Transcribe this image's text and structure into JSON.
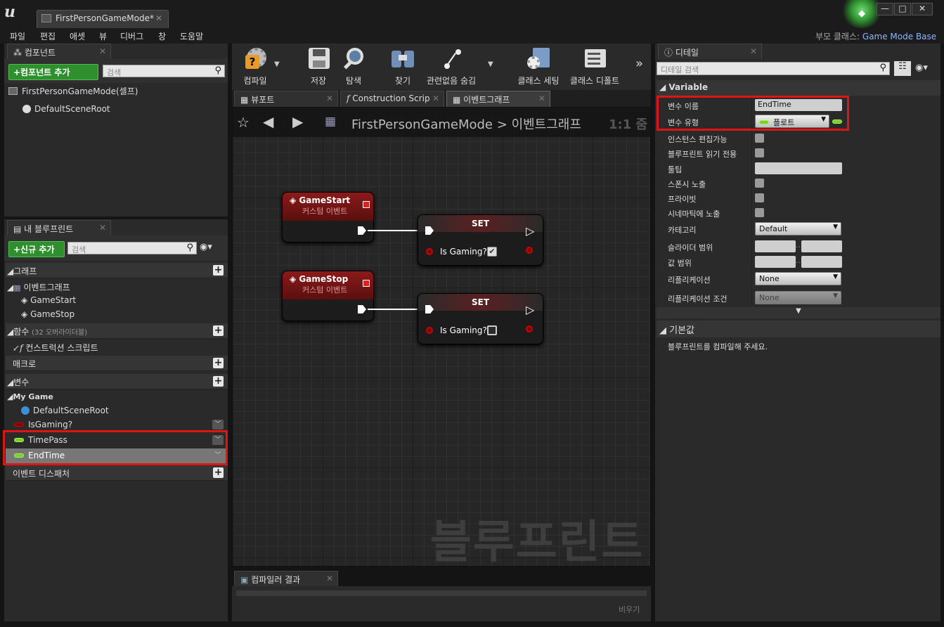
{
  "window": {
    "tab_title": "FirstPersonGameMode*",
    "parent_class_label": "부모 클래스:",
    "parent_class_value": "Game Mode Base",
    "min": "—",
    "max": "□",
    "close": "✕"
  },
  "menu": [
    "파일",
    "편집",
    "애셋",
    "뷰",
    "디버그",
    "창",
    "도움말"
  ],
  "components": {
    "tab": "컴포넌트",
    "add_button": "+컴포넌트 추가",
    "search_placeholder": "검색",
    "root": "FirstPersonGameMode(셀프)",
    "child": "DefaultSceneRoot"
  },
  "my_blueprint": {
    "tab": "내 블루프린트",
    "add_button": "+신규 추가",
    "search_placeholder": "검색",
    "graph_header": "그래프",
    "event_graph": "이벤트그래프",
    "events": [
      "GameStart",
      "GameStop"
    ],
    "functions_header": "함수",
    "functions_note": "(32 오버라이더블)",
    "construction_script": "컨스트럭션 스크립트",
    "macros_header": "매크로",
    "variables_header": "변수",
    "var_group": "My Game",
    "variables": [
      {
        "name": "DefaultSceneRoot",
        "type": "component"
      },
      {
        "name": "IsGaming?",
        "type": "bool",
        "color": "#8a0000"
      },
      {
        "name": "TimePass",
        "type": "float",
        "color": "#7ad02a"
      },
      {
        "name": "EndTime",
        "type": "float",
        "color": "#7ad02a"
      }
    ],
    "dispatchers_header": "이벤트 디스패처"
  },
  "toolbar": [
    {
      "label": "컴파일",
      "icon": "compile-icon"
    },
    {
      "label": "저장",
      "icon": "save-icon"
    },
    {
      "label": "탐색",
      "icon": "browse-icon"
    },
    {
      "label": "찾기",
      "icon": "find-icon"
    },
    {
      "label": "관련없음 숨김",
      "icon": "hide-unrelated-icon"
    },
    {
      "label": "클래스 세팅",
      "icon": "class-settings-icon"
    },
    {
      "label": "클래스 디폴트",
      "icon": "class-defaults-icon"
    }
  ],
  "editor_tabs": [
    "뷰포트",
    "Construction Scrip",
    "이벤트그래프"
  ],
  "graph": {
    "breadcrumb_root": "FirstPersonGameMode",
    "breadcrumb_sep": ">",
    "breadcrumb_leaf": "이벤트그래프",
    "zoom": "1:1 줌",
    "watermark": "블루프린트",
    "nodes": [
      {
        "title": "GameStart",
        "subtitle": "커스텀 이벤트"
      },
      {
        "title": "GameStop",
        "subtitle": "커스텀 이벤트"
      }
    ],
    "set_nodes": [
      {
        "title": "SET",
        "pin": "Is Gaming?",
        "checked": true
      },
      {
        "title": "SET",
        "pin": "Is Gaming?",
        "checked": false
      }
    ]
  },
  "compiler": {
    "tab": "컴파일러 결과",
    "clear": "비우기"
  },
  "details": {
    "tab": "디테일",
    "search_placeholder": "디테일 검색",
    "section_variable": "Variable",
    "var_name_label": "변수 이름",
    "var_name_value": "EndTime",
    "var_type_label": "변수 유형",
    "var_type_value": "플로트",
    "instance_editable": "인스턴스 편집가능",
    "bp_read_only": "블루프린트 읽기 전용",
    "tooltip": "툴팁",
    "expose_spawn": "스폰시 노출",
    "private": "프라이빗",
    "expose_cinematic": "시네마틱에 노출",
    "category_label": "카테고리",
    "category_value": "Default",
    "slider_range": "슬라이더 범위",
    "value_range": "값 범위",
    "replication_label": "리플리케이션",
    "replication_value": "None",
    "replication_cond_label": "리플리케이션 조건",
    "replication_cond_value": "None",
    "section_default": "기본값",
    "default_msg": "블루프린트를 컴파일해 주세요."
  }
}
